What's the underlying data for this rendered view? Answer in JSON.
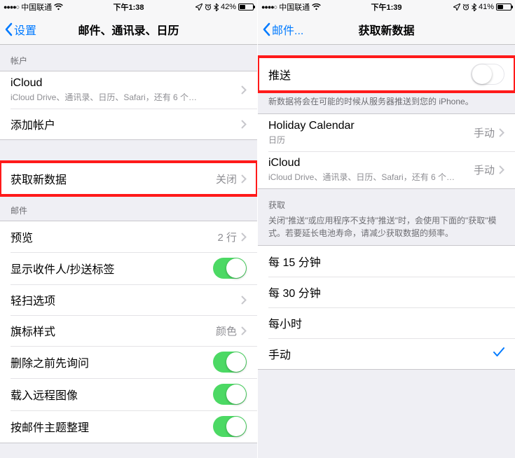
{
  "left": {
    "status": {
      "carrier": "中国联通",
      "time": "下午1:38",
      "battery_pct": "42%",
      "battery_fill": 42
    },
    "nav": {
      "back": "设置",
      "title": "邮件、通讯录、日历"
    },
    "sections": {
      "accounts_header": "帐户",
      "icloud": {
        "title": "iCloud",
        "sub": "iCloud Drive、通讯录、日历、Safari，还有 6 个…"
      },
      "add_account": "添加帐户",
      "fetch": {
        "title": "获取新数据",
        "detail": "关闭"
      },
      "mail_header": "邮件",
      "preview": {
        "title": "预览",
        "detail": "2 行"
      },
      "show_to_cc": "显示收件人/抄送标签",
      "swipe_options": "轻扫选项",
      "flag_style": {
        "title": "旗标样式",
        "detail": "颜色"
      },
      "ask_before_delete": "删除之前先询问",
      "load_remote_images": "载入远程图像",
      "organize_by_thread": "按邮件主题整理"
    }
  },
  "right": {
    "status": {
      "carrier": "中国联通",
      "time": "下午1:39",
      "battery_pct": "41%",
      "battery_fill": 41
    },
    "nav": {
      "back": "邮件...",
      "title": "获取新数据"
    },
    "push": {
      "title": "推送",
      "footer": "新数据将会在可能的时候从服务器推送到您的 iPhone。"
    },
    "accounts": {
      "holiday": {
        "title": "Holiday Calendar",
        "sub": "日历",
        "detail": "手动"
      },
      "icloud": {
        "title": "iCloud",
        "sub": "iCloud Drive、通讯录、日历、Safari，还有 6 个…",
        "detail": "手动"
      }
    },
    "fetch": {
      "header": "获取",
      "footer": "关闭\"推送\"或应用程序不支持\"推送\"时，会使用下面的\"获取\"模式。若要延长电池寿命，请减少获取数据的频率。",
      "opt_15": "每 15 分钟",
      "opt_30": "每 30 分钟",
      "opt_hour": "每小时",
      "opt_manual": "手动"
    }
  }
}
